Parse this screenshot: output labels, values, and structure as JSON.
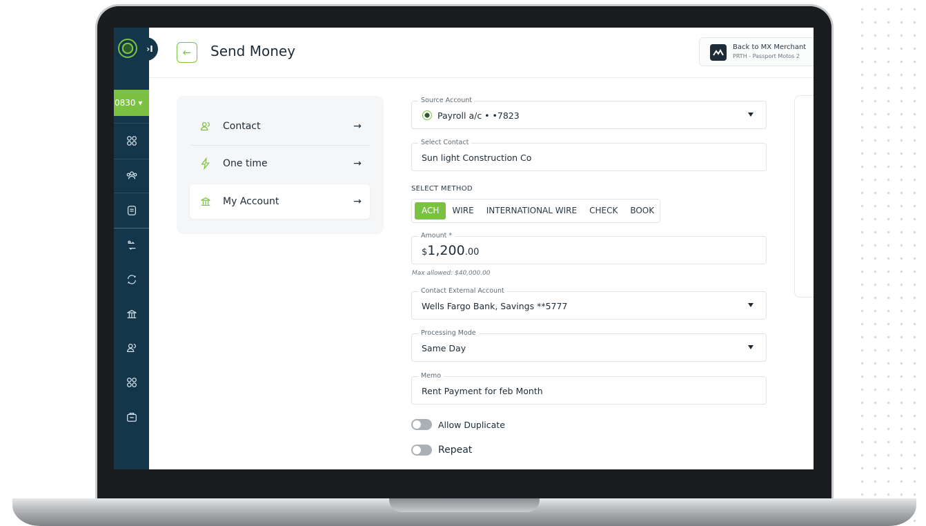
{
  "sidebar": {
    "account_id": "0830 ▾",
    "collapse_glyph": "›I"
  },
  "header": {
    "back_glyph": "←",
    "title": "Send Money",
    "merchant_button": {
      "title": "Back to MX Merchant",
      "subtitle": "PRTH - Passport Motos 2"
    }
  },
  "menu": {
    "items": [
      {
        "label": "Contact",
        "icon": "contact-icon"
      },
      {
        "label": "One time",
        "icon": "lightning-icon"
      },
      {
        "label": "My Account",
        "icon": "bank-icon",
        "active": true
      }
    ],
    "arrow": "→"
  },
  "form": {
    "source_account": {
      "label": "Source Account",
      "value": "Payroll a/c • •7823"
    },
    "contact": {
      "label": "Select Contact",
      "value": "Sun light Construction Co"
    },
    "method": {
      "label": "SELECT METHOD",
      "options": [
        "ACH",
        "WIRE",
        "INTERNATIONAL WIRE",
        "CHECK",
        "BOOK"
      ],
      "selected": "ACH"
    },
    "amount": {
      "label": "Amount *",
      "currency": "$",
      "whole": "1,200",
      "cents": ".00",
      "hint": "Max allowed: $40,000.00"
    },
    "external_account": {
      "label": "Contact External Account",
      "value": "Wells Fargo Bank, Savings **5777"
    },
    "processing_mode": {
      "label": "Processing Mode",
      "value": "Same Day"
    },
    "memo": {
      "label": "Memo",
      "value": "Rent Payment for feb Month"
    },
    "allow_duplicate": {
      "label": "Allow Duplicate",
      "on": false
    },
    "repeat": {
      "label": "Repeat",
      "on": false
    }
  },
  "colors": {
    "accent": "#7bc142",
    "sidebar": "#14364a",
    "text": "#1d2b36"
  }
}
